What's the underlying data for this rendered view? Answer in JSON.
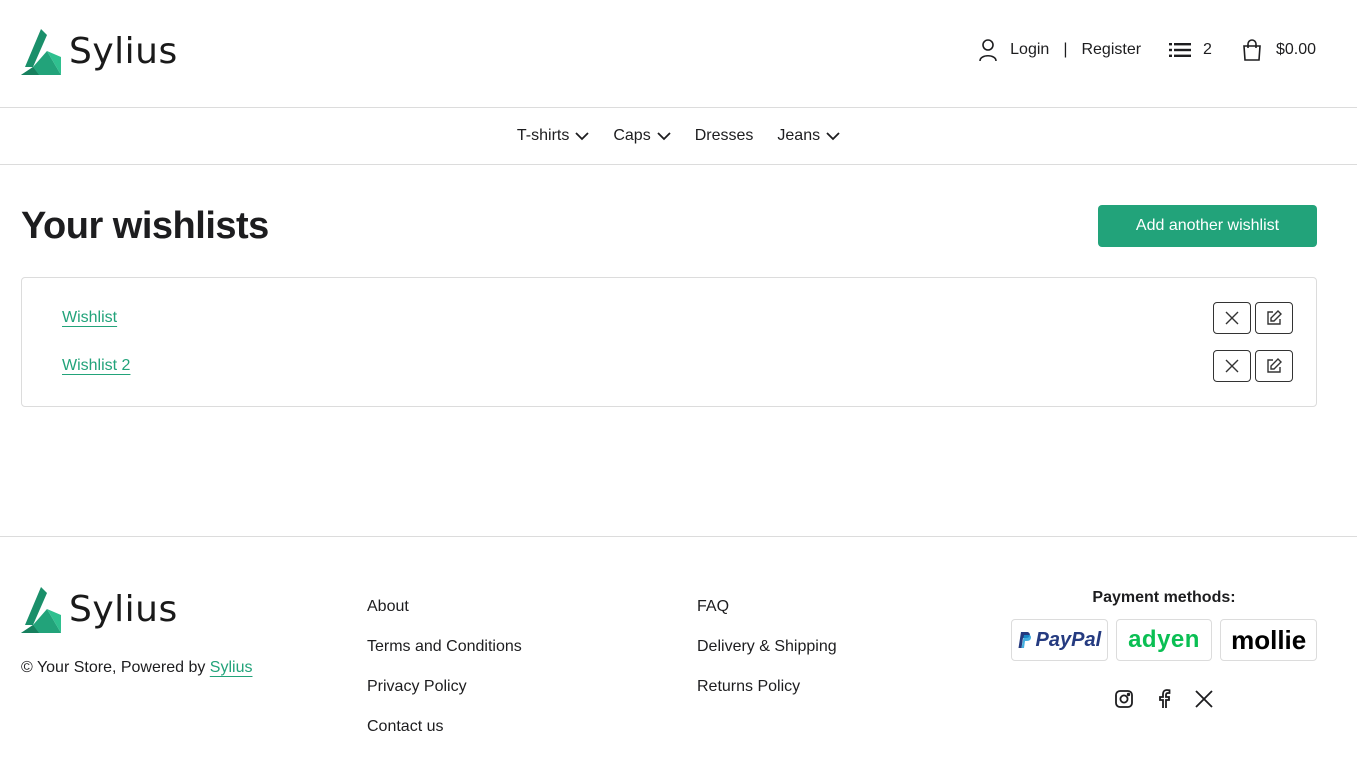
{
  "brand": {
    "name": "Sylius",
    "accent": "#22a37a"
  },
  "header": {
    "login_label": "Login",
    "separator": "|",
    "register_label": "Register",
    "wishlist_count": "2",
    "cart_total": "$0.00"
  },
  "nav": {
    "items": [
      {
        "label": "T-shirts",
        "has_dropdown": true
      },
      {
        "label": "Caps",
        "has_dropdown": true
      },
      {
        "label": "Dresses",
        "has_dropdown": false
      },
      {
        "label": "Jeans",
        "has_dropdown": true
      }
    ]
  },
  "main": {
    "title": "Your wishlists",
    "add_button_label": "Add another wishlist",
    "wishlists": [
      {
        "name": "Wishlist"
      },
      {
        "name": "Wishlist 2"
      }
    ]
  },
  "footer": {
    "copyright_prefix": "© Your Store, Powered by",
    "copyright_link": "Sylius",
    "col1": [
      "About",
      "Terms and Conditions",
      "Privacy Policy",
      "Contact us"
    ],
    "col2": [
      "FAQ",
      "Delivery & Shipping",
      "Returns Policy"
    ],
    "payments_title": "Payment methods:",
    "payment_methods": [
      "PayPal",
      "adyen",
      "mollie"
    ],
    "socials": [
      "instagram-icon",
      "facebook-icon",
      "x-icon"
    ]
  }
}
